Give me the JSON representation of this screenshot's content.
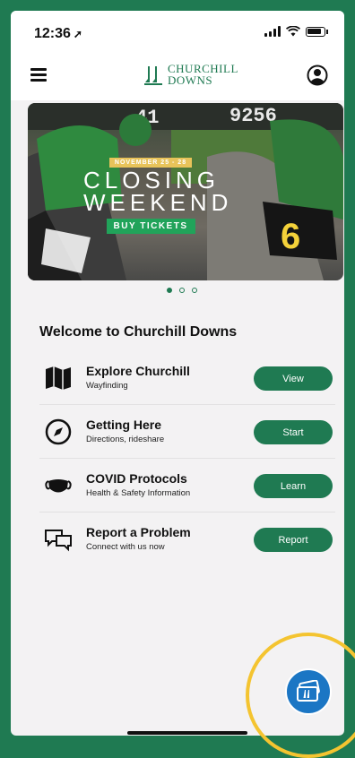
{
  "status_bar": {
    "time": "12:36"
  },
  "header": {
    "logo_line1": "CHURCHILL",
    "logo_line2": "DOWNS"
  },
  "banner": {
    "date_label": "NOVEMBER 25 - 28",
    "title_line1": "CLOSING",
    "title_line2": "WEEKEND",
    "button_label": "BUY TICKETS",
    "carousel_dots": 3,
    "active_dot": 1
  },
  "welcome": {
    "heading": "Welcome to Churchill Downs"
  },
  "items": [
    {
      "title": "Explore Churchill",
      "subtitle": "Wayfinding",
      "button": "View",
      "icon": "map-icon"
    },
    {
      "title": "Getting Here",
      "subtitle": "Directions, rideshare",
      "button": "Start",
      "icon": "compass-icon"
    },
    {
      "title": "COVID Protocols",
      "subtitle": "Health & Safety Information",
      "button": "Learn",
      "icon": "mask-icon"
    },
    {
      "title": "Report a Problem",
      "subtitle": "Connect with us now",
      "button": "Report",
      "icon": "chat-bubbles-icon"
    }
  ],
  "colors": {
    "brand_green": "#1f7a52",
    "fab_blue": "#1b76c4",
    "highlight_yellow": "#f4c430"
  }
}
